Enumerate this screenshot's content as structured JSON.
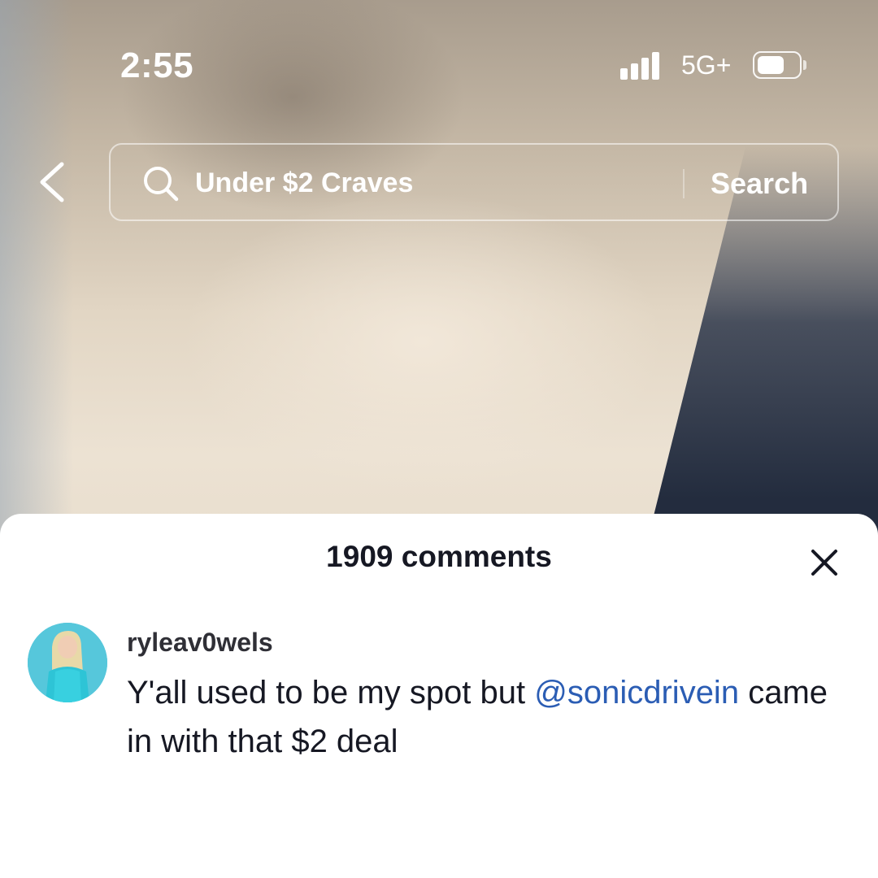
{
  "status_bar": {
    "time": "2:55",
    "network": "5G+"
  },
  "search": {
    "query": "Under $2 Craves",
    "button_label": "Search"
  },
  "comments": {
    "count_label": "1909 comments",
    "items": [
      {
        "username": "ryleav0wels",
        "text_before": "Y'all used to be my spot but ",
        "mention": "@sonicdrivein",
        "text_after": " came in with that $2 deal"
      }
    ]
  },
  "colors": {
    "mention_link": "#2b5db4",
    "text_primary": "#161823",
    "sheet_background": "#ffffff"
  },
  "icons": [
    "back-chevron-icon",
    "search-icon",
    "close-icon",
    "signal-icon",
    "battery-icon"
  ]
}
